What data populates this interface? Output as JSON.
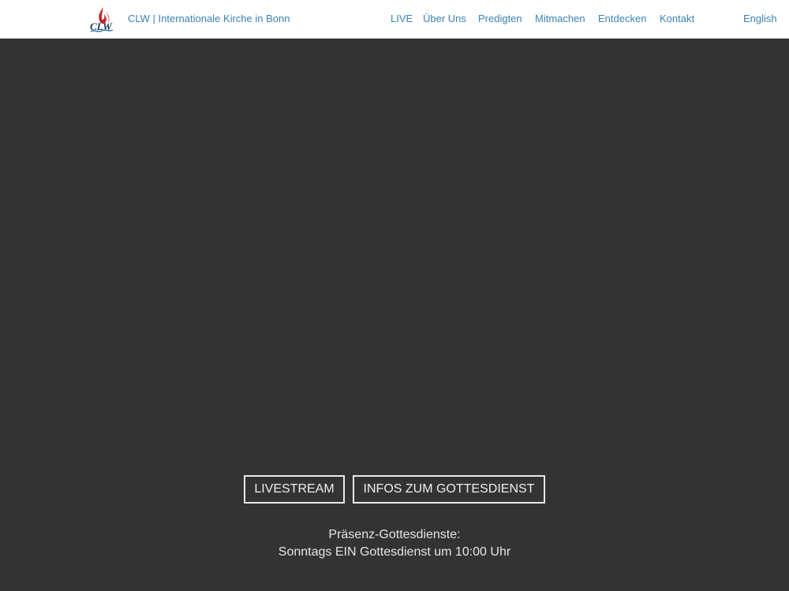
{
  "header": {
    "site_title": "CLW | Internationale Kirche in Bonn",
    "logo_text": "CLW",
    "nav": [
      {
        "label": "LIVE"
      },
      {
        "label": "Über Uns"
      },
      {
        "label": "Predigten"
      },
      {
        "label": "Mitmachen"
      },
      {
        "label": "Entdecken"
      },
      {
        "label": "Kontakt"
      }
    ],
    "language": "English"
  },
  "hero": {
    "buttons": {
      "livestream": "LIVESTREAM",
      "infos": "INFOS ZUM GOTTESDIENST"
    },
    "service_line1": "Präsenz-Gottesdienste:",
    "service_line2": "Sonntags EIN Gottesdienst um 10:00 Uhr"
  },
  "colors": {
    "link": "#3a82b5",
    "hero_background": "#333333",
    "logo_red": "#c0262c",
    "logo_navy": "#1d3557"
  }
}
